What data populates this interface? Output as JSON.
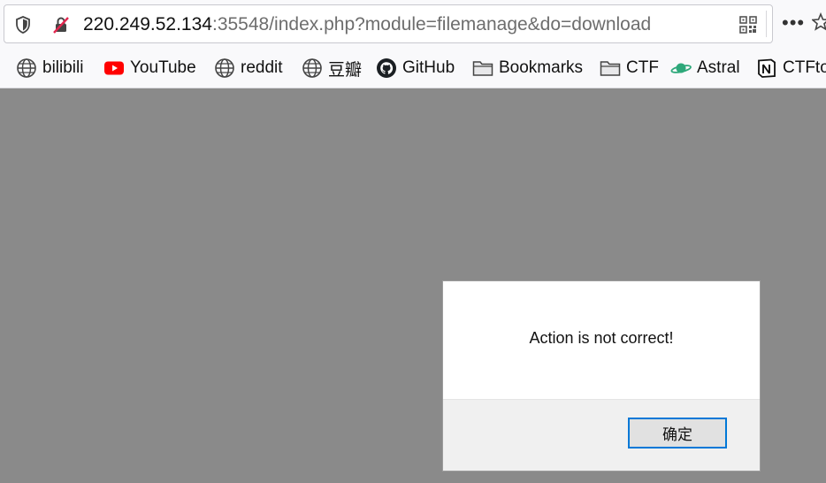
{
  "urlbar": {
    "host": "220.249.52.134",
    "rest": ":35548/index.php?module=filemanage&do=download",
    "more_label": "•••"
  },
  "bookmarks": [
    {
      "label": "bilibili",
      "icon": "globe-icon"
    },
    {
      "label": "YouTube",
      "icon": "youtube-icon"
    },
    {
      "label": "reddit",
      "icon": "globe-icon"
    },
    {
      "label": "豆瓣",
      "icon": "globe-icon"
    },
    {
      "label": "GitHub",
      "icon": "github-icon"
    },
    {
      "label": "Bookmarks",
      "icon": "folder-icon"
    },
    {
      "label": "CTF",
      "icon": "folder-icon"
    },
    {
      "label": "Astral",
      "icon": "planet-icon"
    },
    {
      "label": "CTFto",
      "icon": "notion-icon"
    }
  ],
  "dialog": {
    "message": "Action is not correct!",
    "ok_label": "确定"
  },
  "colors": {
    "overlay": "#8a8a8a",
    "button_focus": "#0078d7",
    "youtube": "#ff0000",
    "astral": "#2ea87a"
  }
}
